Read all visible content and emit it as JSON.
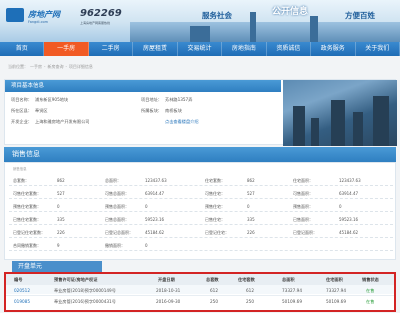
{
  "header": {
    "brand": "房地产网",
    "brand_sub": "Fangdi.com",
    "phone": "962269",
    "phone_sub": "上海房地产网客服热线",
    "slogans": [
      "服务社会",
      "公开信息",
      "方便百姓"
    ]
  },
  "nav": [
    "首页",
    "一手房",
    "二手房",
    "房屋租赁",
    "交易统计",
    "房地指南",
    "资质诚信",
    "政务服务",
    "关于我们"
  ],
  "nav_active": 1,
  "breadcrumb": [
    "当前位置：",
    "一手房",
    "新房查询",
    "项目详细信息"
  ],
  "project": {
    "section": "项目基本信息",
    "name_label": "项目名称：",
    "name": "浦东新区905地块",
    "address_label": "项目地址：",
    "address": "芳林路1357弄",
    "district_label": "所在区县：",
    "district": "奉贤区",
    "area_label": "所属板块：",
    "area": "南桥板块",
    "developer_label": "开发企业：",
    "developer": "上海和雅房地产开发有限公司",
    "more_link": "点击查看楼盘介绍"
  },
  "sales": {
    "title": "销售信息",
    "subtitle": "销售信息",
    "rows": [
      [
        "总套数：",
        "862",
        "总面积：",
        "123437.63",
        "住宅套数：",
        "862",
        "住宅面积：",
        "123437.63"
      ],
      [
        "可售住宅套数：",
        "527",
        "可售总面积：",
        "63914.47",
        "可售住宅：",
        "527",
        "可售面积：",
        "63914.47"
      ],
      [
        "预售住宅套数：",
        "0",
        "预售总面积：",
        "0",
        "预售住宅：",
        "0",
        "预售面积：",
        "0"
      ],
      [
        "已售住宅套数：",
        "335",
        "已售总面积：",
        "59523.16",
        "已售住宅：",
        "335",
        "已售面积：",
        "59523.16"
      ],
      [
        "已登记住宅套数：",
        "226",
        "已登记总面积：",
        "45184.62",
        "已登记住宅：",
        "226",
        "已登记面积：",
        "45184.62"
      ],
      [
        "合同撤销套数：",
        "9",
        "撤销面积：",
        "0",
        "",
        "",
        "",
        ""
      ]
    ]
  },
  "units": {
    "title": "开盘单元",
    "headers": [
      "编号",
      "预售许可证/房地产权证",
      "开盘日期",
      "总套数",
      "住宅套数",
      "总面积",
      "住宅面积",
      "销售状态"
    ],
    "rows": [
      [
        "020512",
        "奉业房管(2018)预字0000149号",
        "2018-10-31",
        "612",
        "612",
        "73327.94",
        "73327.94",
        "在售"
      ],
      [
        "019085",
        "奉业房管(2016)预字0000431号",
        "2016-09-30",
        "250",
        "250",
        "50109.69",
        "50109.69",
        "在售"
      ]
    ]
  },
  "colors": {
    "nav_active": "#f15a24",
    "brand": "#1e6fb8",
    "highlight": "#d32424"
  }
}
